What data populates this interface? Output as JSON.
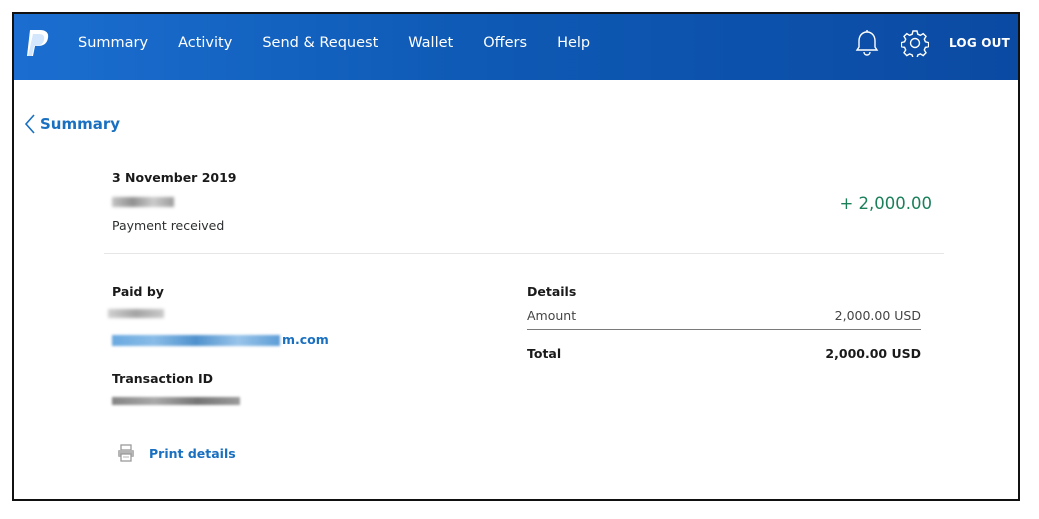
{
  "nav": {
    "items": [
      "Summary",
      "Activity",
      "Send & Request",
      "Wallet",
      "Offers",
      "Help"
    ],
    "logout_label": "LOG OUT"
  },
  "back_link": {
    "label": "Summary"
  },
  "transaction": {
    "date": "3 November 2019",
    "type": "Payment received",
    "amount": "+ 2,000.00"
  },
  "paid_by": {
    "label": "Paid by",
    "email_suffix": "m.com"
  },
  "transaction_id": {
    "label": "Transaction ID"
  },
  "print": {
    "label": "Print details"
  },
  "details": {
    "title": "Details",
    "amount_label": "Amount",
    "amount_value": "2,000.00 USD",
    "total_label": "Total",
    "total_value": "2,000.00 USD"
  },
  "colors": {
    "header": "#0e5ab5",
    "link": "#1a70c0",
    "positive_amount": "#1b7f5a"
  },
  "icons": {
    "logo": "paypal-logo-icon",
    "notifications": "bell-icon",
    "settings": "gear-icon",
    "back": "chevron-left-icon",
    "print": "printer-icon"
  }
}
